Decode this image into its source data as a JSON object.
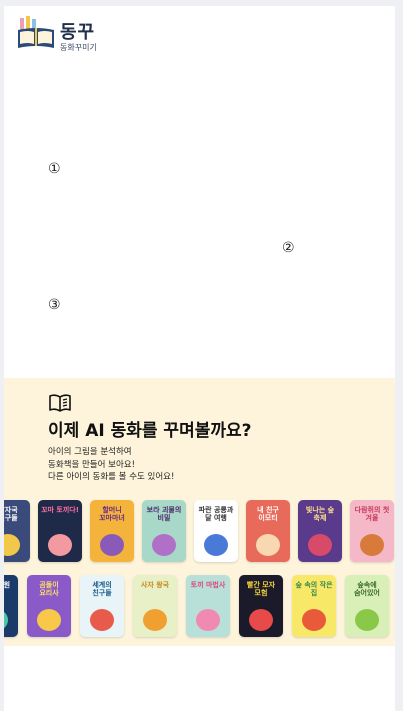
{
  "logo": {
    "title": "동꾸",
    "subtitle": "동화꾸미기"
  },
  "steps": [
    "①",
    "②",
    "③"
  ],
  "promo": {
    "title": "이제 AI 동화를 꾸며볼까요?",
    "description": [
      "아이의 그림을 분석하여",
      "동화책을 만들어 보아요!",
      "다른 아이의 동화를 볼 수도 있어요!"
    ]
  },
  "books_row1": [
    {
      "caption": "발자국 친구들",
      "bg": "#3a4a7a",
      "fg": "#ffffff",
      "accent": "#f2c84b"
    },
    {
      "caption": "꼬마 토끼다!",
      "bg": "#1e2a48",
      "fg": "#ff6fa0",
      "accent": "#f29aa0"
    },
    {
      "caption": "할머니 꼬마마녀",
      "bg": "#f4b43c",
      "fg": "#6a2a8a",
      "accent": "#8a5ab8"
    },
    {
      "caption": "보라 괴물의 비밀",
      "bg": "#a8d8c8",
      "fg": "#4a2a6a",
      "accent": "#b070c8"
    },
    {
      "caption": "파란 공룡과 달 여행",
      "bg": "#ffffff",
      "fg": "#333333",
      "accent": "#4a7ad8"
    },
    {
      "caption": "내 친구 이모티",
      "bg": "#e86a5a",
      "fg": "#ffffff",
      "accent": "#f8d8b0"
    },
    {
      "caption": "빛나는 숲 축제",
      "bg": "#5a3a8a",
      "fg": "#ffe08a",
      "accent": "#d84a6a"
    },
    {
      "caption": "다람쥐의 첫 겨울",
      "bg": "#f4b8c8",
      "fg": "#c83a5a",
      "accent": "#d87a3a"
    }
  ],
  "books_row2": [
    {
      "caption": "하늘 정원",
      "bg": "#1a3a6a",
      "fg": "#ffffff",
      "accent": "#4ac8a8"
    },
    {
      "caption": "곰돌이 요리사",
      "bg": "#8a5ac8",
      "fg": "#ffe066",
      "accent": "#f8c84a"
    },
    {
      "caption": "세계의 친구들",
      "bg": "#e8f4f8",
      "fg": "#1a5a8a",
      "accent": "#e85a4a"
    },
    {
      "caption": "사자 왕국",
      "bg": "#e8f0c8",
      "fg": "#c8881a",
      "accent": "#f0a030"
    },
    {
      "caption": "토끼 마법사",
      "bg": "#b8e0d8",
      "fg": "#d8487a",
      "accent": "#f08ab0"
    },
    {
      "caption": "빨간 모자 모험",
      "bg": "#1a1a2a",
      "fg": "#f8d83a",
      "accent": "#e84a4a"
    },
    {
      "caption": "숲 속의 작은 집",
      "bg": "#f8e868",
      "fg": "#3a8a4a",
      "accent": "#e85a3a"
    },
    {
      "caption": "숲속에 숨어있어",
      "bg": "#d8f0b8",
      "fg": "#3a6a2a",
      "accent": "#8ac84a"
    }
  ]
}
